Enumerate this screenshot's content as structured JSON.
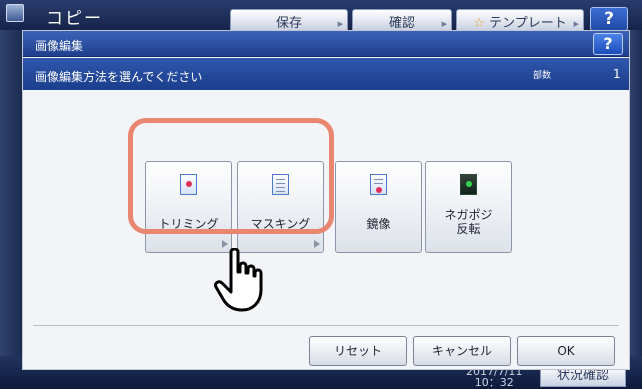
{
  "background": {
    "app_title": "コピー",
    "toolbar": {
      "save_label": "保存",
      "confirm_label": "確認",
      "template_label": "テンプレート"
    },
    "help_label": "?",
    "clock": "2017/7/11\n10：32",
    "status_label": "状況確認"
  },
  "dialog": {
    "title": "画像編集",
    "help_label": "?",
    "instruction": "画像編集方法を選んでください",
    "copies_label": "部数",
    "copies_value": "1",
    "options": [
      {
        "label": "トリミング",
        "icon": "trimming-icon"
      },
      {
        "label": "マスキング",
        "icon": "masking-icon"
      },
      {
        "label": "鏡像",
        "icon": "mirror-image-icon"
      },
      {
        "label": "ネガポジ\n反転",
        "icon": "negative-positive-icon"
      }
    ],
    "buttons": {
      "reset_label": "リセット",
      "cancel_label": "キャンセル",
      "ok_label": "OK"
    }
  },
  "colors": {
    "header_blue": "#1e3f8c",
    "highlight": "#e8866f"
  }
}
